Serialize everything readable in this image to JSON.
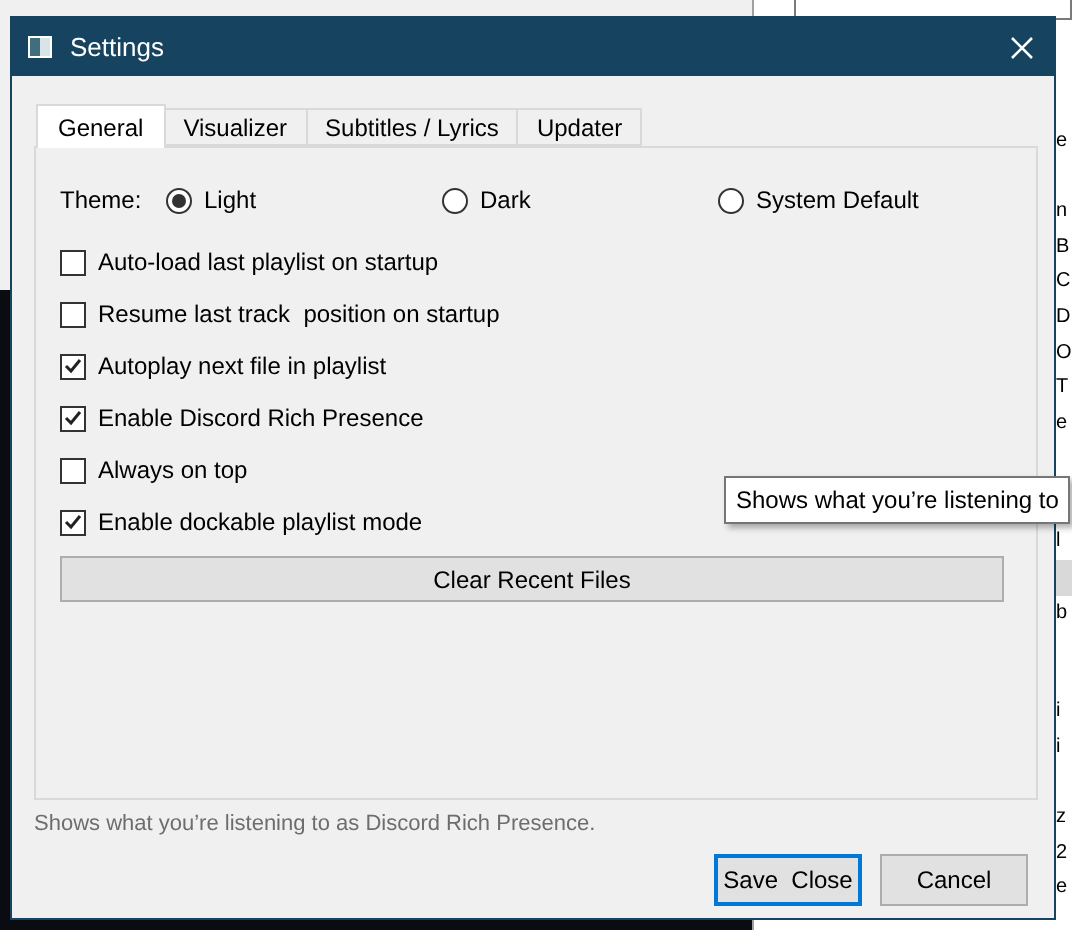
{
  "background_app": {
    "list_groups": [
      [
        {
          "selected": false
        }
      ],
      [
        {
          "text": "e",
          "selected": false
        }
      ],
      [
        {
          "text": "n",
          "selected": false
        },
        {
          "text": "B",
          "selected": false
        },
        {
          "text": "C",
          "selected": false
        },
        {
          "text": "D",
          "selected": false
        },
        {
          "text": "O",
          "selected": false
        },
        {
          "text": "T",
          "selected": false
        },
        {
          "text": "e",
          "selected": false
        }
      ],
      [
        {
          "text": "l",
          "selected": false
        },
        {
          "selected": true
        },
        {
          "text": "b",
          "selected": false
        }
      ],
      [
        {
          "text": "i",
          "selected": false
        },
        {
          "text": "i",
          "selected": false
        },
        {
          "selected": false
        },
        {
          "text": "z",
          "selected": false
        },
        {
          "text": "2",
          "selected": false
        },
        {
          "text": "e",
          "selected": false
        }
      ]
    ]
  },
  "window": {
    "title": "Settings"
  },
  "tabs": [
    {
      "label": "General",
      "selected": true
    },
    {
      "label": "Visualizer",
      "selected": false
    },
    {
      "label": "Subtitles / Lyrics",
      "selected": false
    },
    {
      "label": "Updater",
      "selected": false
    }
  ],
  "theme": {
    "label": "Theme:",
    "options": [
      {
        "label": "Light",
        "selected": true
      },
      {
        "label": "Dark",
        "selected": false
      },
      {
        "label": "System Default",
        "selected": false
      }
    ]
  },
  "options": [
    {
      "label": "Auto-load last playlist on startup",
      "checked": false
    },
    {
      "label": "Resume last track  position on startup",
      "checked": false
    },
    {
      "label": "Autoplay next file in playlist",
      "checked": true
    },
    {
      "label": "Enable Discord Rich Presence",
      "checked": true
    },
    {
      "label": "Always on top",
      "checked": false
    },
    {
      "label": "Enable dockable playlist mode",
      "checked": true
    }
  ],
  "clear_button": "Clear Recent Files",
  "help_text": "Shows what you’re listening to as Discord Rich Presence.",
  "tooltip": "Shows what you’re listening to",
  "buttons": [
    {
      "label": "Save  Close",
      "kind": "default"
    },
    {
      "label": "Cancel",
      "kind": "normal"
    }
  ]
}
